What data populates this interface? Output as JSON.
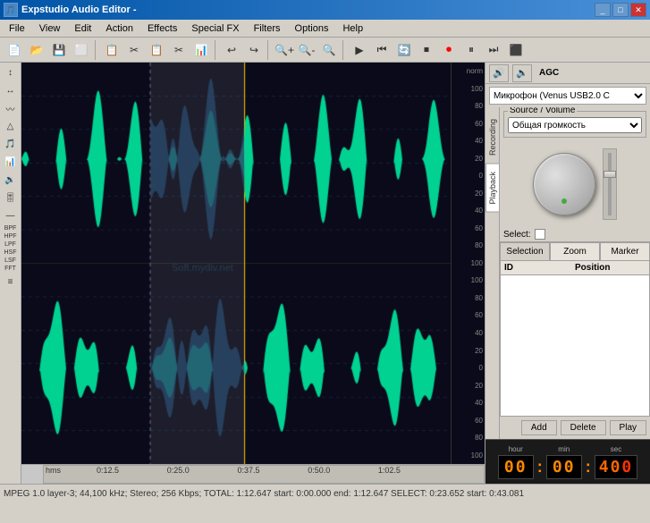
{
  "titleBar": {
    "title": "Expstudio Audio Editor -",
    "icon": "🎵"
  },
  "menuBar": {
    "items": [
      "File",
      "View",
      "Edit",
      "Action",
      "Effects",
      "Special FX",
      "Filters",
      "Options",
      "Help"
    ]
  },
  "toolbar": {
    "buttons": [
      "📂",
      "💾",
      "⬜",
      "✂",
      "📋",
      "📋",
      "✂",
      "📊",
      "↩",
      "↪",
      "🔍",
      "🔍",
      "🔍",
      "▶",
      "⏮",
      "🔄",
      "⏹",
      "⏺",
      "⏸",
      "⏭",
      "⬛"
    ]
  },
  "leftToolbar": {
    "buttons": [
      "↕",
      "↔",
      "〰",
      "△",
      "🎵",
      "📊",
      "🔉",
      "🎚",
      "—",
      "BPF",
      "HPF",
      "LPF",
      "HSF",
      "LSF",
      "FFT",
      "≡"
    ]
  },
  "waveform": {
    "scaleValues": [
      "norm",
      "100",
      "80",
      "60",
      "40",
      "20",
      "0",
      "20",
      "40",
      "60",
      "80",
      "100",
      "100",
      "80",
      "60",
      "40",
      "20",
      "0",
      "20",
      "40",
      "60",
      "80",
      "100"
    ]
  },
  "timeline": {
    "labels": [
      "hms",
      "0:12.5",
      "0:25.0",
      "0:37.5",
      "0:50.0",
      "1:02.5"
    ]
  },
  "rightPanel": {
    "deviceName": "Микрофон (Venus USB2.0 C",
    "sourceLabel": "Source / Volume",
    "sourceVolume": "Общая громкость",
    "tabs": {
      "recording": "Recording",
      "playback": "Playback"
    },
    "selectLabel": "Select:",
    "markerTabs": [
      "Selection",
      "Zoom",
      "Marker"
    ],
    "markerColumns": [
      "ID",
      "Position"
    ],
    "buttons": {
      "add": "Add",
      "delete": "Delete",
      "play": "Play"
    }
  },
  "timer": {
    "hourLabel": "hour",
    "minLabel": "min",
    "secLabel": "sec",
    "hour": "00",
    "min": "00",
    "sec": "40",
    "fracSec": "0"
  },
  "statusBar": {
    "text": "MPEG 1.0 layer-3;  44,100 kHz; Stereo; 256 Kbps;   TOTAL: 1:12.647   start: 0:00.000  end: 1:12.647  SELECT: 0:23.652  start: 0:43.081"
  }
}
